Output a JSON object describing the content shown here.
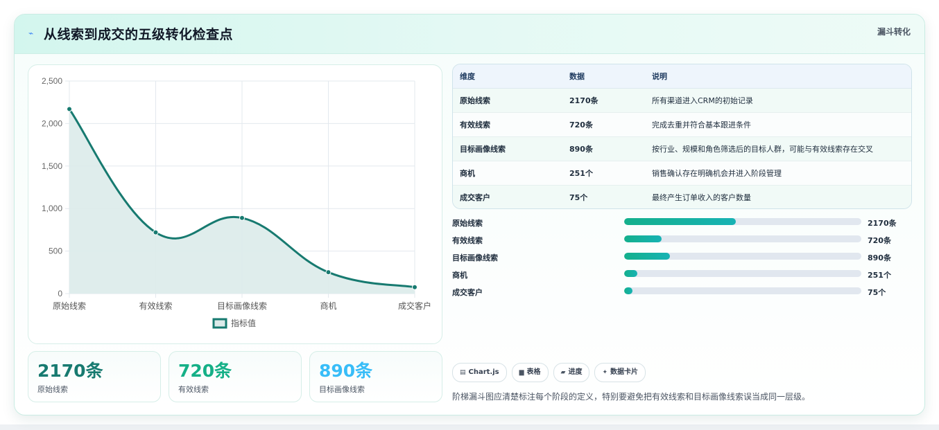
{
  "header": {
    "title": "从线索到成交的五级转化检查点",
    "tag": "漏斗转化",
    "icon": "lightning-icon"
  },
  "chart_data": {
    "type": "line",
    "categories": [
      "原始线索",
      "有效线索",
      "目标画像线索",
      "商机",
      "成交客户"
    ],
    "series": [
      {
        "name": "指标值",
        "values": [
          2170,
          720,
          890,
          251,
          75
        ]
      }
    ],
    "yticks": [
      "0",
      "500",
      "1,000",
      "1,500",
      "2,000",
      "2,500"
    ],
    "ylim": [
      0,
      2500
    ],
    "grid": true,
    "legend": "bottom",
    "line_color": "#177a70",
    "fill_color": "#dcebea"
  },
  "stats": [
    {
      "value": "2170条",
      "label": "原始线索",
      "color": "#177a70"
    },
    {
      "value": "720条",
      "label": "有效线索",
      "color": "#15b087"
    },
    {
      "value": "890条",
      "label": "目标画像线索",
      "color": "#38bdf8"
    }
  ],
  "table": {
    "headers": [
      "维度",
      "数据",
      "说明"
    ],
    "rows": [
      [
        "原始线索",
        "2170条",
        "所有渠道进入CRM的初始记录"
      ],
      [
        "有效线索",
        "720条",
        "完成去重并符合基本跟进条件"
      ],
      [
        "目标画像线索",
        "890条",
        "按行业、规模和角色筛选后的目标人群，可能与有效线索存在交叉"
      ],
      [
        "商机",
        "251个",
        "销售确认存在明确机会并进入阶段管理"
      ],
      [
        "成交客户",
        "75个",
        "最终产生订单收入的客户数量"
      ]
    ]
  },
  "progress": [
    {
      "label": "原始线索",
      "value": "2170条",
      "fraction": 0.472
    },
    {
      "label": "有效线索",
      "value": "720条",
      "fraction": 0.157
    },
    {
      "label": "目标画像线索",
      "value": "890条",
      "fraction": 0.193
    },
    {
      "label": "商机",
      "value": "251个",
      "fraction": 0.055
    },
    {
      "label": "成交客户",
      "value": "75个",
      "fraction": 0.035
    }
  ],
  "chips": [
    {
      "label": "Chart.js",
      "icon": "chart-icon"
    },
    {
      "label": "表格",
      "icon": "table-icon"
    },
    {
      "label": "进度",
      "icon": "progress-icon"
    },
    {
      "label": "数据卡片",
      "icon": "sparkle-icon"
    }
  ],
  "footnote": "阶梯漏斗图应清楚标注每个阶段的定义，特别要避免把有效线索和目标画像线索误当成同一层级。"
}
